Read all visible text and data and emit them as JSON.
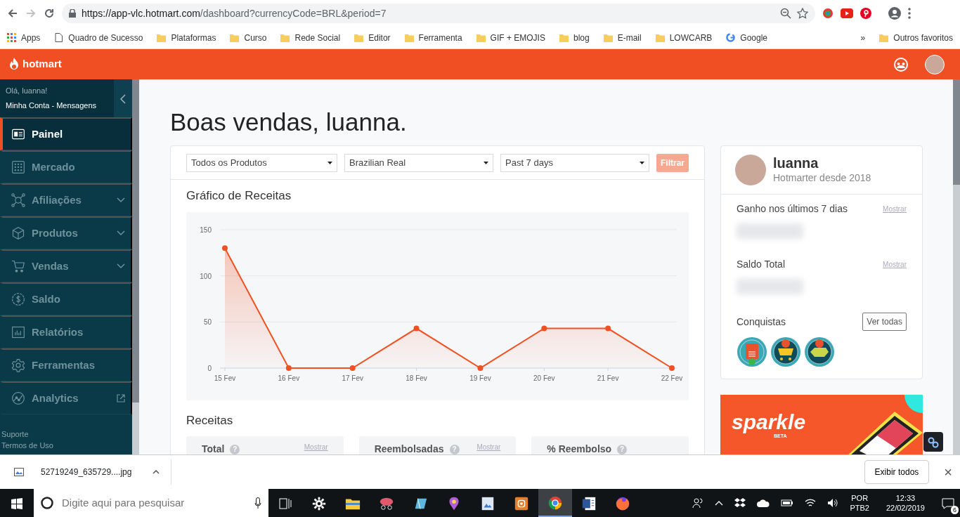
{
  "browser": {
    "forward_disabled": true,
    "url_host": "https://app-vlc.hotmart.com",
    "url_path": "/dashboard?currencyCode=BRL&period=7",
    "bookmarks": [
      {
        "kind": "apps",
        "label": "Apps"
      },
      {
        "kind": "page",
        "label": "Quadro de Sucesso"
      },
      {
        "kind": "folder",
        "label": "Plataformas"
      },
      {
        "kind": "folder",
        "label": "Curso"
      },
      {
        "kind": "folder",
        "label": "Rede Social"
      },
      {
        "kind": "folder",
        "label": "Editor"
      },
      {
        "kind": "folder",
        "label": "Ferramenta"
      },
      {
        "kind": "folder",
        "label": "GIF + EMOJIS"
      },
      {
        "kind": "folder",
        "label": "blog"
      },
      {
        "kind": "folder",
        "label": "E-mail"
      },
      {
        "kind": "folder",
        "label": "LOWCARB"
      },
      {
        "kind": "google",
        "label": "Google"
      }
    ],
    "overflow": "»",
    "other_bookmarks": "Outros favoritos"
  },
  "header": {
    "logo": "hotmart"
  },
  "sidebar": {
    "greeting": "Olá, luanna!",
    "account": "Minha Conta - Mensagens",
    "items": [
      {
        "kind": "panel",
        "label": "Painel",
        "selected": true,
        "submenu": false,
        "external": false
      },
      {
        "kind": "grid",
        "label": "Mercado",
        "selected": false,
        "submenu": false,
        "external": false
      },
      {
        "kind": "network",
        "label": "Afiliações",
        "selected": false,
        "submenu": true,
        "external": false
      },
      {
        "kind": "cube",
        "label": "Produtos",
        "selected": false,
        "submenu": true,
        "external": false
      },
      {
        "kind": "cart",
        "label": "Vendas",
        "selected": false,
        "submenu": true,
        "external": false
      },
      {
        "kind": "coin",
        "label": "Saldo",
        "selected": false,
        "submenu": false,
        "external": false
      },
      {
        "kind": "bars",
        "label": "Relatórios",
        "selected": false,
        "submenu": false,
        "external": false
      },
      {
        "kind": "gear",
        "label": "Ferramentas",
        "selected": false,
        "submenu": false,
        "external": false
      },
      {
        "kind": "trend",
        "label": "Analytics",
        "selected": false,
        "submenu": false,
        "external": true
      }
    ],
    "footer_links": [
      "Suporte",
      "Termos de Uso"
    ]
  },
  "main": {
    "title": "Boas vendas, luanna.",
    "filters": [
      {
        "value": "Todos os Produtos"
      },
      {
        "value": "Brazilian Real"
      },
      {
        "value": "Past 7 days"
      }
    ],
    "filter_button": {
      "label": "Filtrar",
      "disabled": true
    },
    "chart_title": "Gráfico de Receitas",
    "chart_data": {
      "type": "line",
      "categories": [
        "15 Fev",
        "16 Fev",
        "17 Fev",
        "18 Fev",
        "19 Fev",
        "20 Fev",
        "21 Fev",
        "22 Fev"
      ],
      "ylim": [
        0,
        150
      ],
      "yticks": [
        0,
        50,
        100,
        150
      ],
      "series": [
        {
          "color": "#f05122",
          "marker": "circle",
          "values": [
            130,
            0,
            0,
            43,
            0,
            43,
            43,
            0
          ]
        }
      ]
    },
    "revenue_title": "Receitas",
    "revenue_cards": [
      {
        "label": "Total",
        "help": "?",
        "action": "Mostrar"
      },
      {
        "label": "Reembolsadas",
        "help": "?",
        "action": "Mostrar"
      },
      {
        "label": "% Reembolso",
        "help": "?"
      }
    ]
  },
  "profile": {
    "name": "luanna",
    "since": "Hotmarter desde 2018",
    "stats": [
      {
        "label": "Ganho nos últimos 7 dias",
        "action": "Mostrar"
      },
      {
        "label": "Saldo Total",
        "action": "Mostrar"
      }
    ],
    "achievements_title": "Conquistas",
    "see_all": "Ver todas",
    "badges": [
      {
        "kind": "document"
      },
      {
        "kind": "cart"
      },
      {
        "kind": "money"
      }
    ]
  },
  "banner": {
    "title": "sparkle",
    "tag": "BETA"
  },
  "download_bar": {
    "file": "52719249_635729....jpg",
    "show_all": "Exibir todos",
    "close": "×"
  },
  "taskbar": {
    "search_placeholder": "Digite aqui para pesquisar",
    "apps": [
      {
        "kind": "settings",
        "active": false
      },
      {
        "kind": "explorer",
        "active": false
      },
      {
        "kind": "snip",
        "active": false
      },
      {
        "kind": "notes",
        "active": false
      },
      {
        "kind": "paint",
        "active": false
      },
      {
        "kind": "image",
        "active": false
      },
      {
        "kind": "camera",
        "active": false
      },
      {
        "kind": "browser",
        "active": true
      },
      {
        "kind": "word",
        "active": false
      },
      {
        "kind": "firefox",
        "active": false
      }
    ],
    "language": "POR",
    "layout": "PTB2",
    "time": "12:33",
    "date": "22/02/2019",
    "notifications": "6"
  }
}
